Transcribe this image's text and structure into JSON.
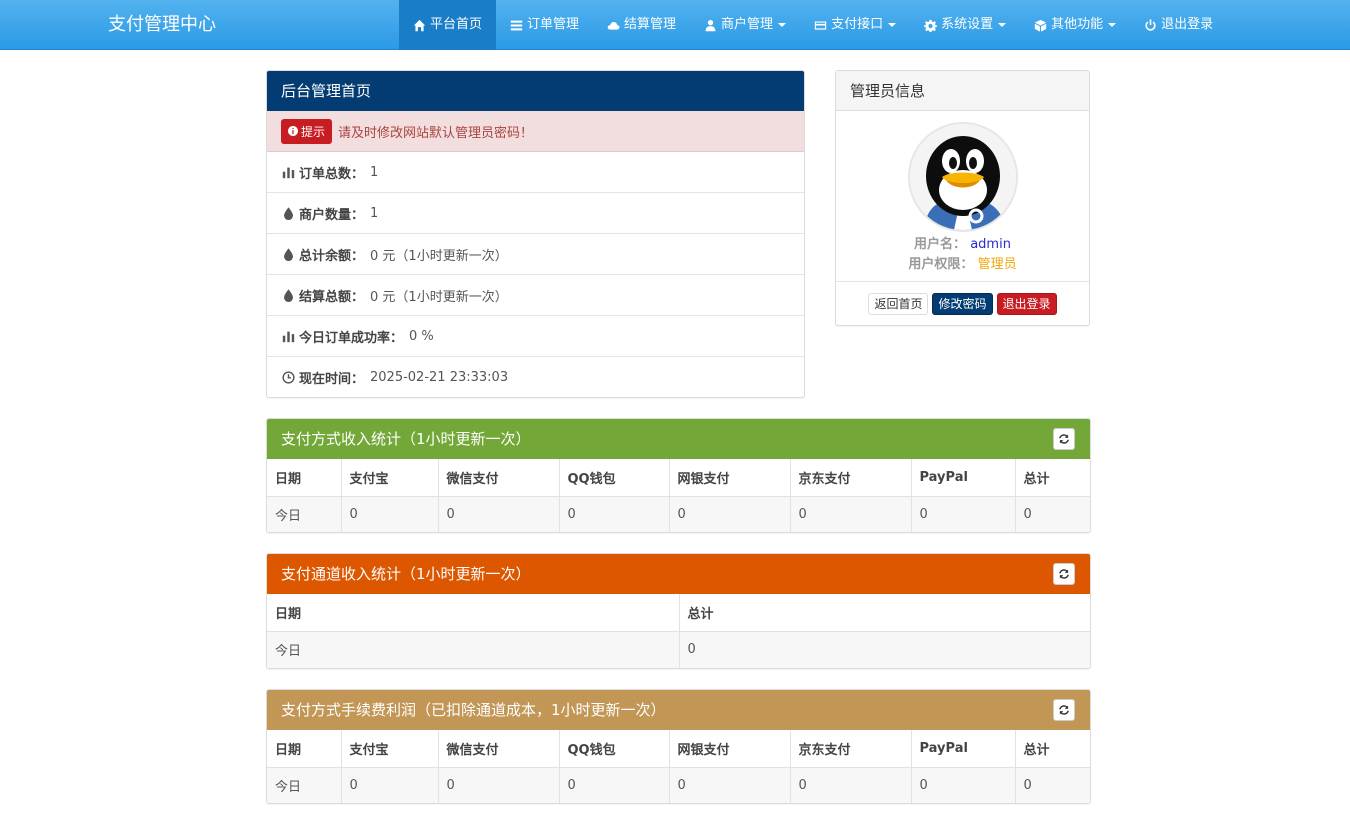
{
  "brand": "支付管理中心",
  "nav": [
    {
      "label": "平台首页",
      "icon": "home-icon",
      "active": true,
      "dropdown": false
    },
    {
      "label": "订单管理",
      "icon": "list-icon",
      "active": false,
      "dropdown": false
    },
    {
      "label": "结算管理",
      "icon": "cloud-icon",
      "active": false,
      "dropdown": false
    },
    {
      "label": "商户管理",
      "icon": "user-icon",
      "active": false,
      "dropdown": true
    },
    {
      "label": "支付接口",
      "icon": "credit-card-icon",
      "active": false,
      "dropdown": true
    },
    {
      "label": "系统设置",
      "icon": "gear-icon",
      "active": false,
      "dropdown": true
    },
    {
      "label": "其他功能",
      "icon": "cube-icon",
      "active": false,
      "dropdown": true
    },
    {
      "label": "退出登录",
      "icon": "power-icon",
      "active": false,
      "dropdown": false
    }
  ],
  "overview": {
    "title": "后台管理首页",
    "alert_badge": "提示",
    "alert_text": "请及时修改网站默认管理员密码！",
    "items": [
      {
        "label": "订单总数：",
        "value": "1",
        "icon": "bar-chart-icon"
      },
      {
        "label": "商户数量：",
        "value": "1",
        "icon": "drop-icon"
      },
      {
        "label": "总计余额：",
        "value": "0 元（1小时更新一次）",
        "icon": "drop-icon"
      },
      {
        "label": "结算总额：",
        "value": "0 元（1小时更新一次）",
        "icon": "drop-icon"
      },
      {
        "label": "今日订单成功率：",
        "value": "0 %",
        "icon": "bar-chart-icon"
      },
      {
        "label": "现在时间：",
        "value": "2025-02-21 23:33:03",
        "icon": "clock-icon"
      }
    ]
  },
  "admin": {
    "title": "管理员信息",
    "username_label": "用户名：",
    "username": "admin",
    "role_label": "用户权限：",
    "role": "管理员",
    "buttons": {
      "home": "返回首页",
      "change_password": "修改密码",
      "logout": "退出登录"
    }
  },
  "table_method": {
    "title": "支付方式收入统计（1小时更新一次）",
    "headers": [
      "日期",
      "支付宝",
      "微信支付",
      "QQ钱包",
      "网银支付",
      "京东支付",
      "PayPal",
      "总计"
    ],
    "rows": [
      [
        "今日",
        "0",
        "0",
        "0",
        "0",
        "0",
        "0",
        "0"
      ]
    ]
  },
  "table_channel": {
    "title": "支付通道收入统计（1小时更新一次）",
    "headers": [
      "日期",
      "总计"
    ],
    "rows": [
      [
        "今日",
        "0"
      ]
    ]
  },
  "table_fee": {
    "title": "支付方式手续费利润（已扣除通道成本，1小时更新一次）",
    "headers": [
      "日期",
      "支付宝",
      "微信支付",
      "QQ钱包",
      "网银支付",
      "京东支付",
      "PayPal",
      "总计"
    ],
    "rows": [
      [
        "今日",
        "0",
        "0",
        "0",
        "0",
        "0",
        "0",
        "0"
      ]
    ]
  },
  "colors": {
    "navbar": "#2b9ae6",
    "heading_navy": "#033c73",
    "heading_green": "#73a839",
    "heading_orange": "#dd5600",
    "heading_tan": "#c29655",
    "danger": "#c71c22"
  }
}
